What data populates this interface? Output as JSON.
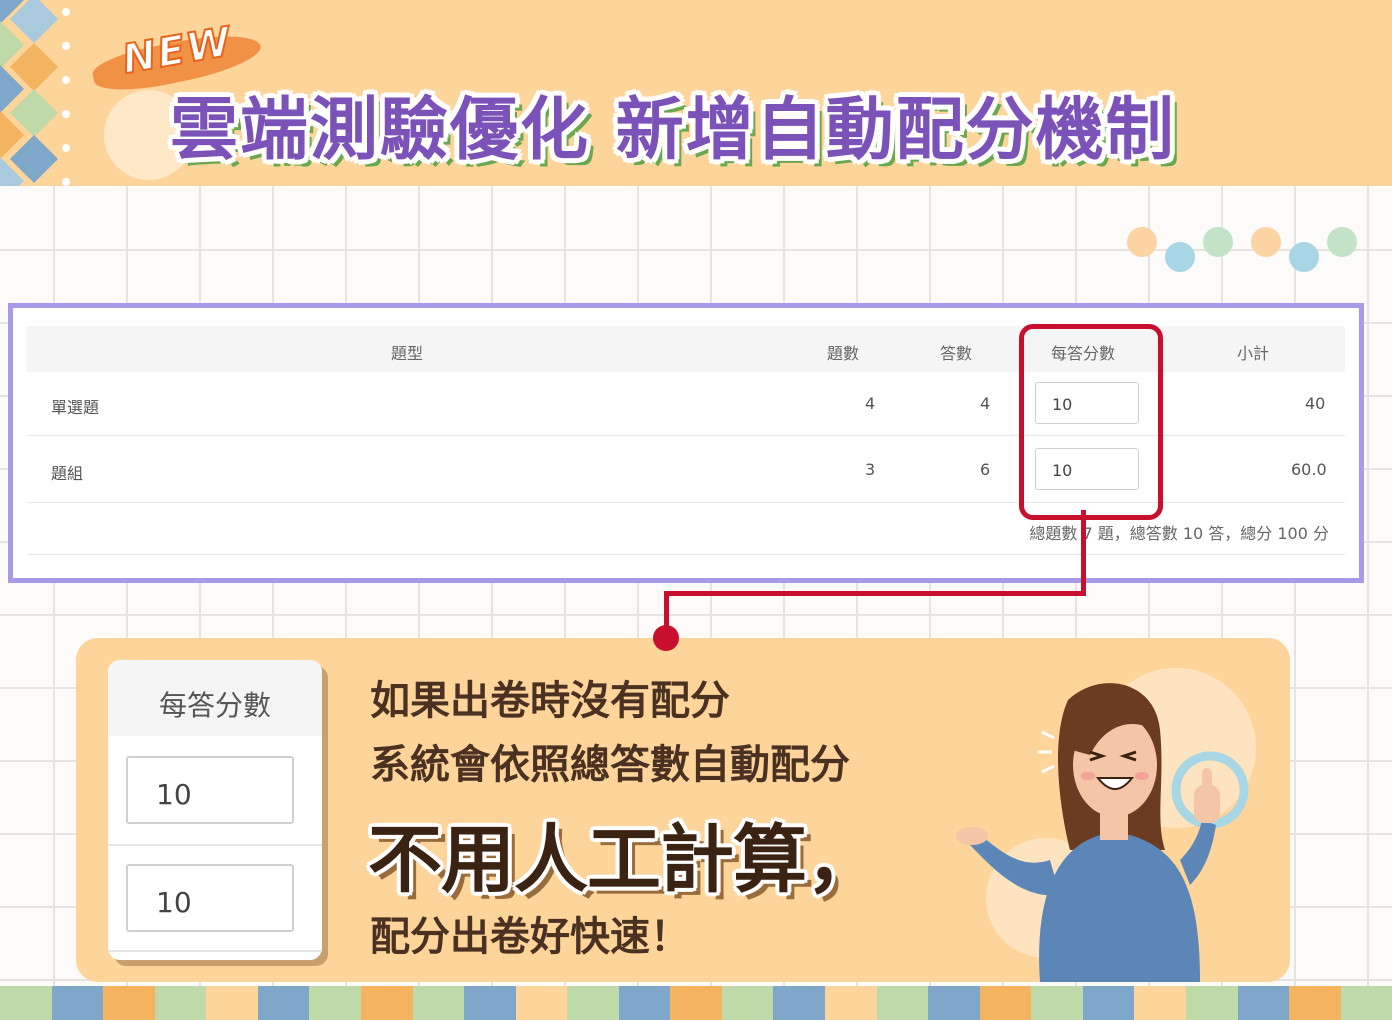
{
  "header": {
    "badge": "NEW",
    "title": "雲端測驗優化  新增自動配分機制"
  },
  "table": {
    "headers": {
      "type": "題型",
      "questions": "題數",
      "answers": "答數",
      "per_answer_score": "每答分數",
      "subtotal": "小計"
    },
    "rows": [
      {
        "type": "單選題",
        "questions": "4",
        "answers": "4",
        "score": "10",
        "subtotal": "40"
      },
      {
        "type": "題組",
        "questions": "3",
        "answers": "6",
        "score": "10",
        "subtotal": "60.0"
      }
    ],
    "summary": "總題數 7 題，總答數 10 答，總分 100 分"
  },
  "mini": {
    "title": "每答分數",
    "values": [
      "10",
      "10"
    ]
  },
  "callout": {
    "line1": "如果出卷時沒有配分",
    "line2": "系統會依照總答數自動配分",
    "line3": "不用人工計算，",
    "line4": "配分出卷好快速！"
  },
  "colors": {
    "header_bg": "#fdd49a",
    "title_purple": "#7a52b8",
    "title_shadow_green": "#6aa84f",
    "panel_border": "#a89ae6",
    "highlight_red": "#c8102e",
    "card_bg": "#fdd49a"
  }
}
